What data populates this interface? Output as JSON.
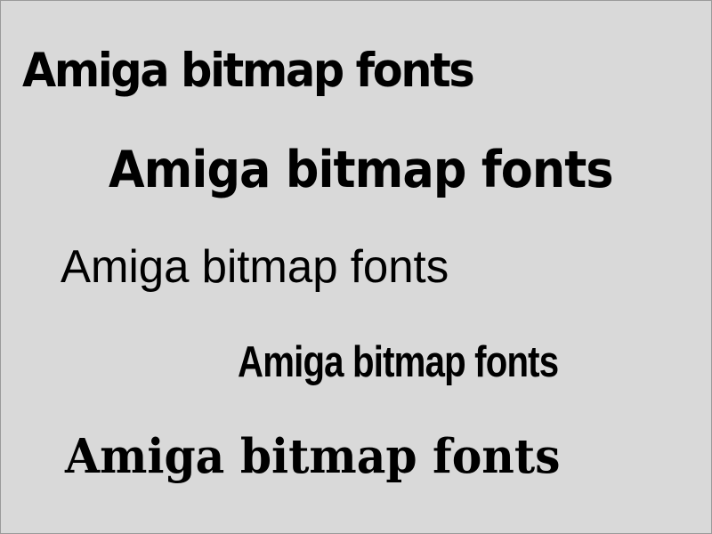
{
  "samples": [
    {
      "text": "Amiga bitmap fonts"
    },
    {
      "text": "Amiga bitmap fonts"
    },
    {
      "text": "Amiga bitmap fonts"
    },
    {
      "text": "Amiga bitmap fonts"
    },
    {
      "text": "Amiga bitmap fonts"
    }
  ],
  "colors": {
    "background": "#d9d9d9",
    "text": "#000000",
    "border": "#9a9a9a"
  }
}
